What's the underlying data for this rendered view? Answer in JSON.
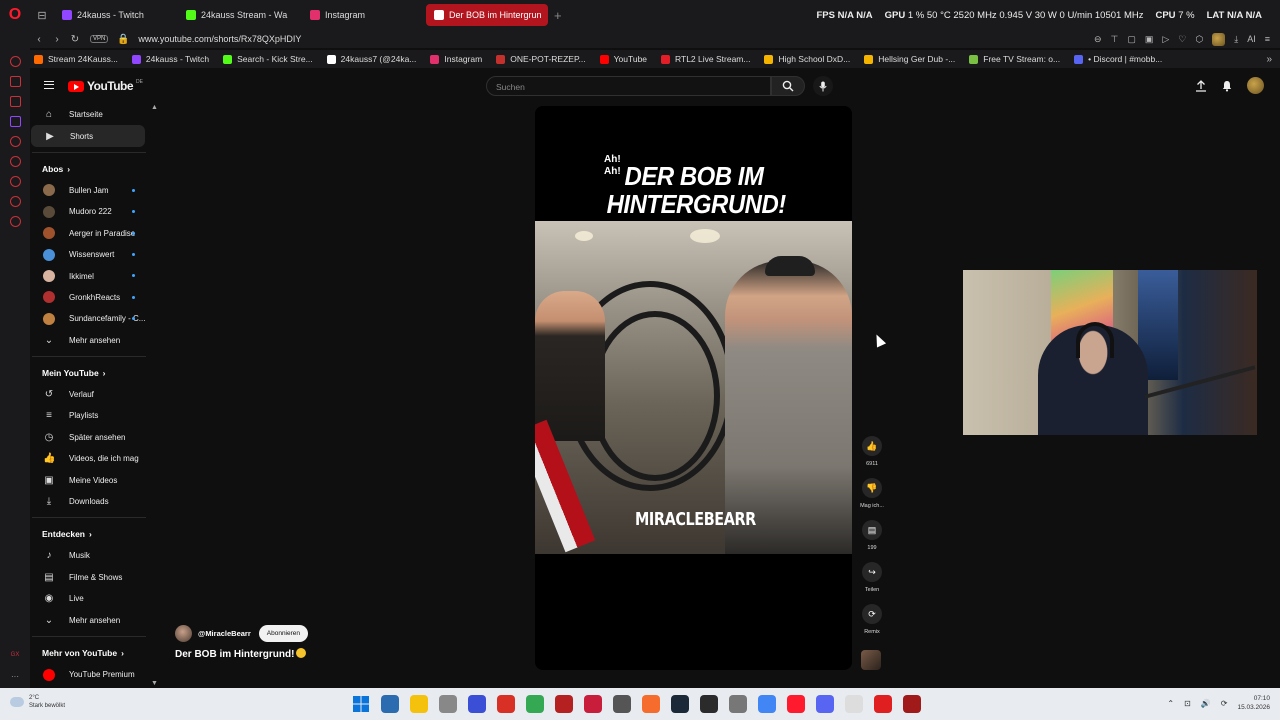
{
  "browser": {
    "tabs": [
      {
        "label": "24kauss - Twitch",
        "color": "#9146ff"
      },
      {
        "label": "24kauss Stream - Wa",
        "color": "#53fc18"
      },
      {
        "label": "Instagram",
        "color": "#e1306c"
      },
      {
        "label": "Der BOB im Hintergrun",
        "color": "#ff0000"
      }
    ],
    "new_tab": "+",
    "stats": {
      "fps_label": "FPS",
      "fps_value": "N/A",
      "fps_value2": "N/A",
      "gpu_label": "GPU",
      "gpu_value": "1 % 50 °C 2520 MHz 0.945 V 30 W 0 U/min 10501 MHz",
      "cpu_label": "CPU",
      "cpu_value": "7 %",
      "lat_label": "LAT",
      "lat_value": "N/A",
      "lat_value2": "N/A"
    },
    "url": "www.youtube.com/shorts/Rx78QXpHDIY",
    "vpn": "VPN",
    "bookmarks": [
      {
        "label": "Stream 24Kauss...",
        "color": "#ff6a00"
      },
      {
        "label": "24kauss - Twitch",
        "color": "#9146ff"
      },
      {
        "label": "Search - Kick Stre...",
        "color": "#53fc18"
      },
      {
        "label": "24kauss7 (@24ka...",
        "color": "#ffffff"
      },
      {
        "label": "Instagram",
        "color": "#e1306c"
      },
      {
        "label": "ONE-POT-REZEP...",
        "color": "#c4302b"
      },
      {
        "label": "YouTube",
        "color": "#ff0000"
      },
      {
        "label": "RTL2 Live Stream...",
        "color": "#e41e26"
      },
      {
        "label": "High School DxD...",
        "color": "#f4b400"
      },
      {
        "label": "Hellsing Ger Dub -...",
        "color": "#f4b400"
      },
      {
        "label": "Free TV Stream: o...",
        "color": "#7ac143"
      },
      {
        "label": "• Discord | #mobb...",
        "color": "#5865f2"
      }
    ]
  },
  "youtube": {
    "logo_text": "YouTube",
    "logo_region": "DE",
    "search_placeholder": "Suchen",
    "sidebar": {
      "main": [
        {
          "label": "Startseite",
          "icon": "home-icon",
          "glyph": "⌂"
        },
        {
          "label": "Shorts",
          "icon": "shorts-icon",
          "glyph": "▶"
        }
      ],
      "subs_heading": "Abos",
      "subs": [
        {
          "label": "Bullen Jam",
          "color": "#8a6a4a"
        },
        {
          "label": "Mudoro 222",
          "color": "#5a4a3a"
        },
        {
          "label": "Aerger in Paradise",
          "color": "#a0522d"
        },
        {
          "label": "Wissenswert",
          "color": "#4a90d9"
        },
        {
          "label": "Ikkimel",
          "color": "#d8b4a0"
        },
        {
          "label": "GronkhReacts",
          "color": "#b03030"
        },
        {
          "label": "Sundancefamily - C...",
          "color": "#c08040"
        }
      ],
      "more1": "Mehr ansehen",
      "you_heading": "Mein YouTube",
      "you": [
        {
          "label": "Verlauf",
          "glyph": "↺"
        },
        {
          "label": "Playlists",
          "glyph": "≡"
        },
        {
          "label": "Später ansehen",
          "glyph": "◷"
        },
        {
          "label": "Videos, die ich mag",
          "glyph": "👍"
        },
        {
          "label": "Meine Videos",
          "glyph": "▣"
        },
        {
          "label": "Downloads",
          "glyph": "⤓"
        }
      ],
      "explore_heading": "Entdecken",
      "explore": [
        {
          "label": "Musik",
          "glyph": "♪"
        },
        {
          "label": "Filme & Shows",
          "glyph": "▤"
        },
        {
          "label": "Live",
          "glyph": "◉"
        }
      ],
      "more2": "Mehr ansehen",
      "more_heading": "Mehr von YouTube",
      "more": [
        {
          "label": "YouTube Premium"
        }
      ]
    },
    "short": {
      "caption_small": "Ah!\nAh!",
      "caption_big": "DER BOB IM HINTERGRUND!",
      "watermark": "MIRACLEBEARR",
      "channel": "@MiracleBearr",
      "subscribe": "Abonnieren",
      "title": "Der BOB im Hintergrund!"
    },
    "actions": [
      {
        "name": "like",
        "glyph": "👍",
        "label": "6911"
      },
      {
        "name": "dislike",
        "glyph": "👎",
        "label": "Mag ich..."
      },
      {
        "name": "comments",
        "glyph": "▤",
        "label": "199"
      },
      {
        "name": "share",
        "glyph": "↪",
        "label": "Teilen"
      },
      {
        "name": "remix",
        "glyph": "⟳",
        "label": "Remix"
      }
    ]
  },
  "taskbar": {
    "weather_temp": "2°C",
    "weather_desc": "Stark bewölkt",
    "time": "07:10",
    "date": "15.03.2026",
    "apps": [
      {
        "name": "start",
        "color": "#0a74da"
      },
      {
        "name": "calculator",
        "color": "#2b6cb0"
      },
      {
        "name": "explorer",
        "color": "#f4c20d"
      },
      {
        "name": "mouse",
        "color": "#888888"
      },
      {
        "name": "v-app",
        "color": "#3a4fd6"
      },
      {
        "name": "red-app",
        "color": "#d93025"
      },
      {
        "name": "green-app",
        "color": "#34a853"
      },
      {
        "name": "game1",
        "color": "#b52020"
      },
      {
        "name": "game2",
        "color": "#c81e3c"
      },
      {
        "name": "circle-app",
        "color": "#555555"
      },
      {
        "name": "origin",
        "color": "#f56c2d"
      },
      {
        "name": "steam",
        "color": "#1b2838"
      },
      {
        "name": "app-dark",
        "color": "#2b2b2b"
      },
      {
        "name": "app-gray",
        "color": "#777777"
      },
      {
        "name": "chrome",
        "color": "#4285f4"
      },
      {
        "name": "opera",
        "color": "#ff1b2d"
      },
      {
        "name": "discord",
        "color": "#5865f2"
      },
      {
        "name": "notes",
        "color": "#dddddd"
      },
      {
        "name": "pdf",
        "color": "#e02020"
      },
      {
        "name": "game3",
        "color": "#a01a1a"
      }
    ]
  }
}
